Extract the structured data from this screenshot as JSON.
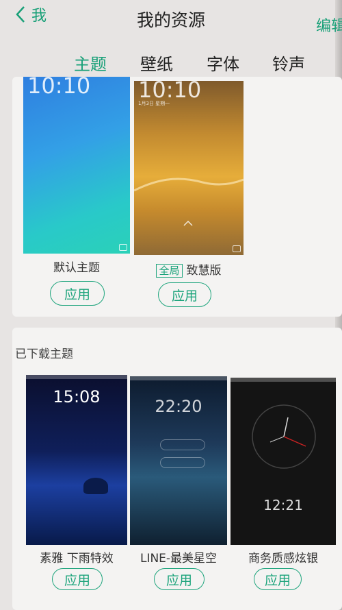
{
  "header": {
    "back_label": "我",
    "title": "我的资源",
    "edit_label": "编辑"
  },
  "tabs": [
    {
      "label": "主题",
      "active": true
    },
    {
      "label": "壁纸",
      "active": false
    },
    {
      "label": "字体",
      "active": false
    },
    {
      "label": "铃声",
      "active": false
    }
  ],
  "current_themes": [
    {
      "name": "默认主题",
      "apply_label": "应用",
      "time": "10:10"
    },
    {
      "badge": "全局",
      "name": "致慧版",
      "apply_label": "应用",
      "time": "10:10",
      "date": "1月3日 星期一"
    }
  ],
  "downloaded": {
    "section_title": "已下载主题",
    "themes": [
      {
        "name": "素雅 下雨特效",
        "apply_label": "应用",
        "time": "15:08"
      },
      {
        "name": "LINE-最美星空",
        "apply_label": "应用",
        "time": "22:20"
      },
      {
        "name": "商务质感炫银",
        "apply_label": "应用",
        "time": "12:21"
      }
    ]
  },
  "colors": {
    "accent": "#1da47c",
    "background": "#e7e4e3",
    "card": "#f4f3f2"
  }
}
